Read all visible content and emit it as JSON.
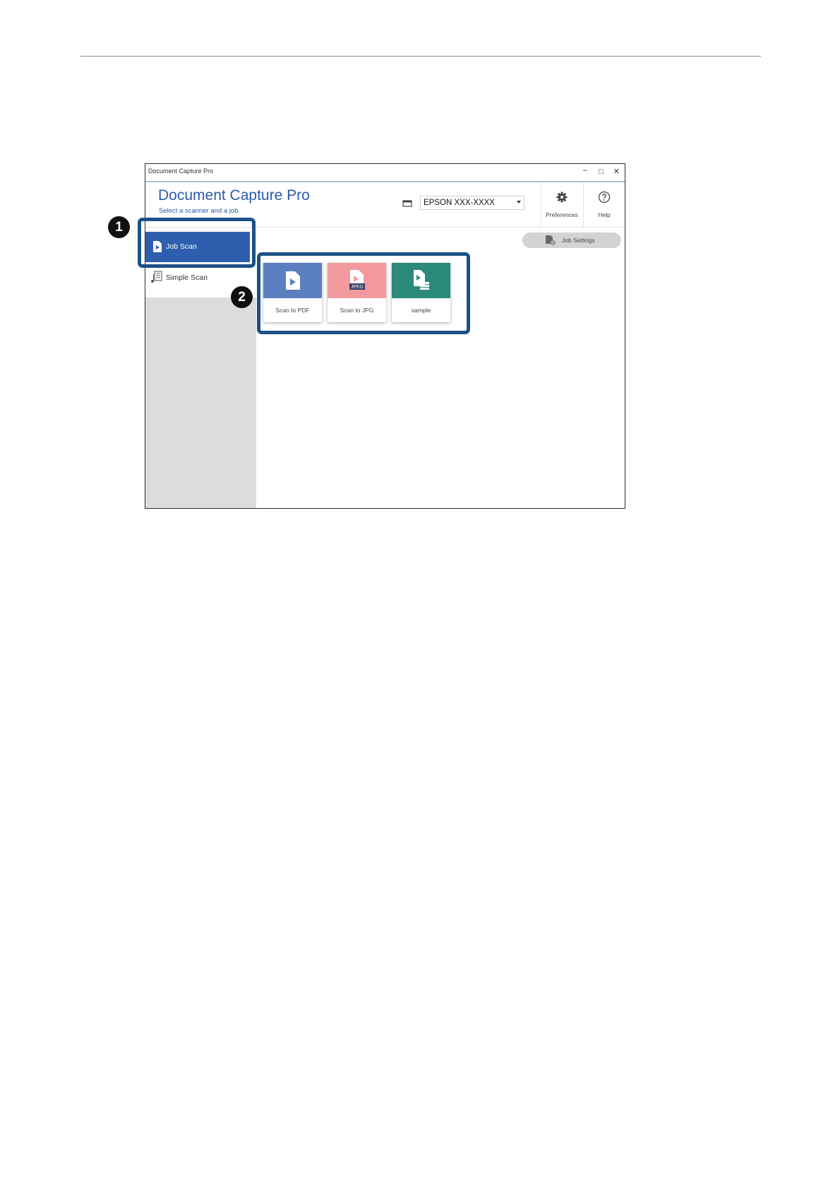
{
  "window": {
    "title": "Document Capture Pro",
    "controls": {
      "minimize": "–",
      "maximize": "□",
      "close": "✕"
    }
  },
  "header": {
    "app_title": "Document Capture Pro",
    "subtitle": "Select a scanner and a job.",
    "scanner_value": "EPSON XXX-XXXX",
    "preferences_label": "Preferences",
    "help_label": "Help"
  },
  "sidebar": {
    "items": [
      {
        "label": "Job Scan",
        "icon": "job-scan-icon",
        "selected": true
      },
      {
        "label": "Simple Scan",
        "icon": "simple-scan-icon",
        "selected": false
      }
    ]
  },
  "main": {
    "job_settings_label": "Job Settings",
    "jobs": [
      {
        "label": "Scan to PDF",
        "color": "#5b7fc0",
        "icon": "pdf-document-icon"
      },
      {
        "label": "Scan to JPG",
        "color": "#f39a9f",
        "icon": "jpeg-document-icon",
        "badge": "JPEG"
      },
      {
        "label": "sample",
        "color": "#2b8a79",
        "icon": "document-stack-icon"
      }
    ]
  },
  "callouts": [
    {
      "number": "1"
    },
    {
      "number": "2"
    }
  ]
}
